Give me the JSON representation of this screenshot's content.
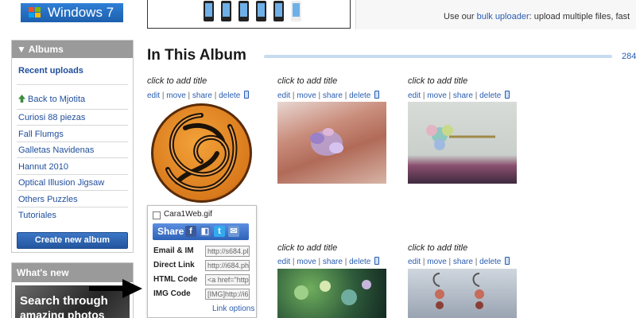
{
  "top": {
    "windows_label": "Windows 7",
    "bulk_prefix": "Use our ",
    "bulk_link": "bulk uploader",
    "bulk_suffix": ": upload multiple files, fast"
  },
  "sidebar": {
    "albums_title": "Albums",
    "recent_uploads": "Recent uploads",
    "back_link": "Back to Mjotita",
    "items": [
      "Curiosi 88 piezas",
      "Fall Flumgs",
      "Galletas Navidenas",
      "Hannut 2010",
      "Optical Illusion Jigsaw",
      "Others Puzzles",
      "Tutoriales"
    ],
    "create_button": "Create new album",
    "whats_new_title": "What's new",
    "promo_line1": "Search through",
    "promo_line2": "amazing photos"
  },
  "main": {
    "album_title": "In This Album",
    "count": "284",
    "cells": [
      {
        "title": "click to add title",
        "edit": "edit",
        "move": "move",
        "share": "share",
        "delete": "delete"
      },
      {
        "title": "click to add title",
        "edit": "edit",
        "move": "move",
        "share": "share",
        "delete": "delete"
      },
      {
        "title": "click to add title",
        "edit": "edit",
        "move": "move",
        "share": "share",
        "delete": "delete"
      },
      {
        "title": "click to add title",
        "edit": "edit",
        "move": "move",
        "share": "share",
        "delete": "delete"
      },
      {
        "title": "click to add title",
        "edit": "edit",
        "move": "move",
        "share": "share",
        "delete": "delete"
      }
    ]
  },
  "share_popup": {
    "filename": "Cara1Web.gif",
    "share_label": "Share",
    "email_label": "Email & IM",
    "email_value": "http://s684.pl",
    "direct_label": "Direct Link",
    "direct_value": "http://i684.ph",
    "html_label": "HTML Code",
    "html_value": "<a href=\"http",
    "img_label": "IMG Code",
    "img_value": "[IMG]http://i6",
    "link_options": "Link options"
  },
  "colors": {
    "link": "#2a5db0",
    "sidebar_header": "#9a9a9a",
    "button_blue": "#2e62b8"
  }
}
